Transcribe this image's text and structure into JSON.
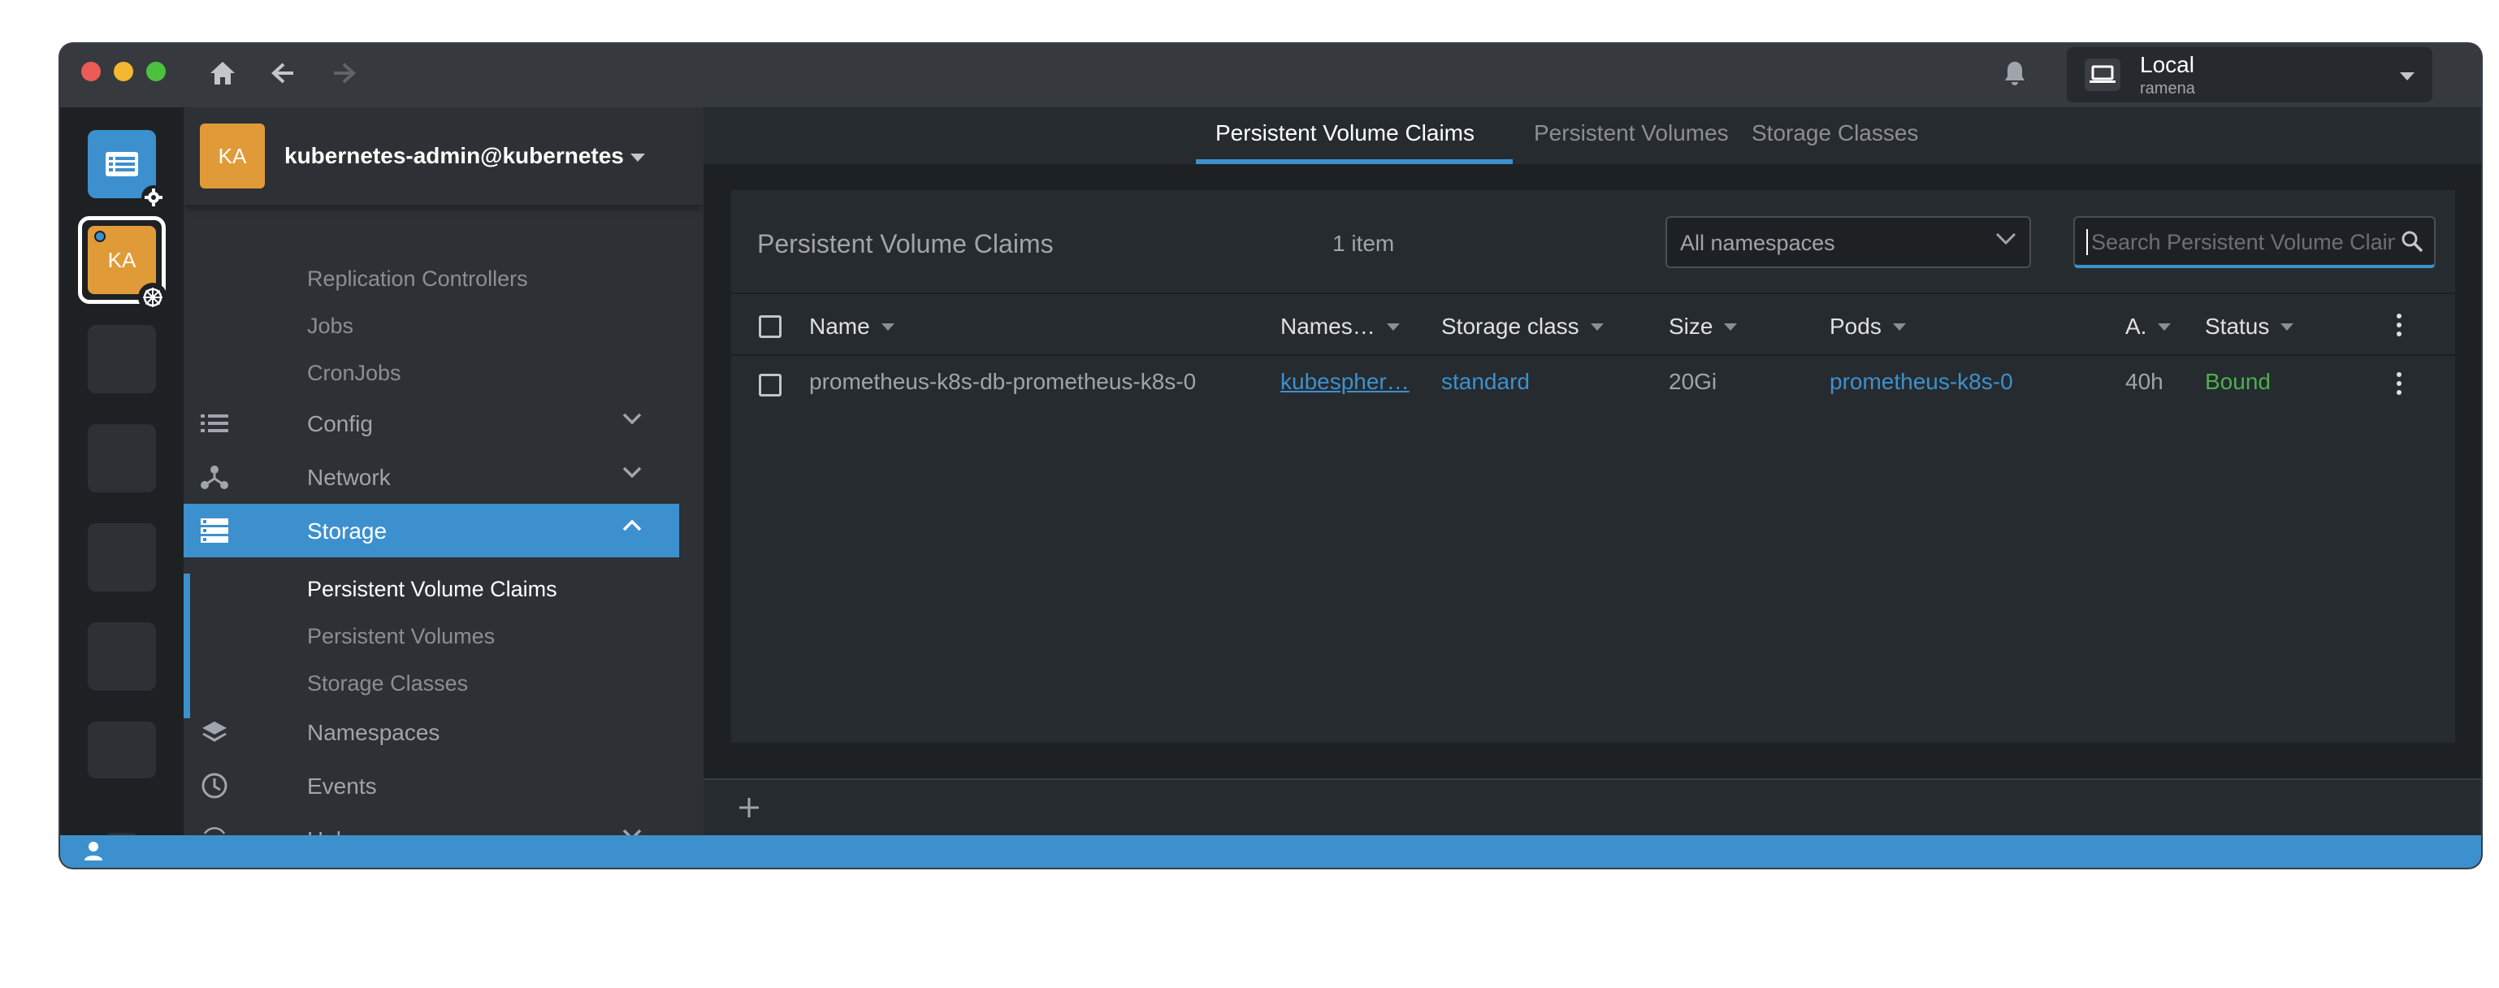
{
  "cluster": {
    "name": "Local",
    "sub": "ramena"
  },
  "hotbar": {
    "catalog_icon": "catalog-list-icon",
    "cluster_initials": "KA",
    "page": "1"
  },
  "sidebar": {
    "avatar": "KA",
    "title": "kubernetes-admin@kubernetes",
    "workload_items": [
      "Replication Controllers",
      "Jobs",
      "CronJobs"
    ],
    "sections": {
      "config": "Config",
      "network": "Network",
      "storage": "Storage",
      "namespaces": "Namespaces",
      "events": "Events",
      "helm": "Helm"
    },
    "storage_items": [
      "Persistent Volume Claims",
      "Persistent Volumes",
      "Storage Classes"
    ]
  },
  "tabs": [
    "Persistent Volume Claims",
    "Persistent Volumes",
    "Storage Classes"
  ],
  "panel": {
    "title": "Persistent Volume Claims",
    "count": "1 item",
    "namespace_filter": "All namespaces",
    "search_placeholder": "Search Persistent Volume Claims..."
  },
  "table": {
    "columns": [
      "Name",
      "Names…",
      "Storage class",
      "Size",
      "Pods",
      "A.",
      "Status"
    ],
    "rows": [
      {
        "name": "prometheus-k8s-db-prometheus-k8s-0",
        "namespace": "kubespher…",
        "storage_class": "standard",
        "size": "20Gi",
        "pods": "prometheus-k8s-0",
        "age": "40h",
        "status": "Bound"
      }
    ]
  },
  "colors": {
    "accent": "#3d90ce",
    "avatar": "#e19a38",
    "status_ok": "#4caf50"
  }
}
